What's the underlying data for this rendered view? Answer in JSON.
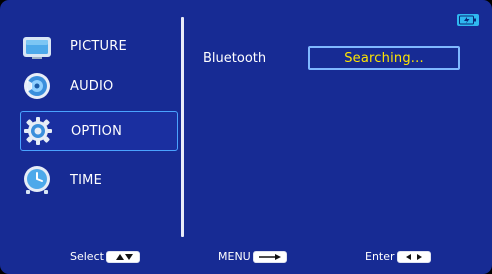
{
  "menu": {
    "items": [
      {
        "label": "PICTURE",
        "icon": "picture-icon"
      },
      {
        "label": "AUDIO",
        "icon": "audio-icon"
      },
      {
        "label": "OPTION",
        "icon": "option-icon",
        "active": true
      },
      {
        "label": "TIME",
        "icon": "time-icon"
      }
    ]
  },
  "settings": {
    "bluetooth_label": "Bluetooth",
    "bluetooth_value": "Searching..."
  },
  "status": {
    "battery_icon": "battery-charging-icon"
  },
  "footer": {
    "select_label": "Select",
    "menu_label": "MENU",
    "enter_label": "Enter"
  },
  "colors": {
    "background": "#172b94",
    "accent": "#4aa3ff",
    "value_text": "#ffe600"
  }
}
